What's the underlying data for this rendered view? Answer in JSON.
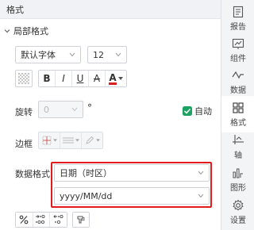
{
  "panel": {
    "title": "格式"
  },
  "section": {
    "title": "局部格式"
  },
  "font": {
    "family": "默认字体",
    "size": "12"
  },
  "style_buttons": {
    "bold": "B",
    "italic": "I",
    "underline": "U",
    "strike": "A",
    "color": "A"
  },
  "rotation": {
    "label": "旋转",
    "value": "0",
    "unit": "°",
    "auto_label": "自动",
    "auto_checked": true
  },
  "border": {
    "label": "边框"
  },
  "data_format": {
    "label": "数据格式",
    "type": "日期（时区）",
    "pattern": "yyyy/MM/dd"
  },
  "sidebar": {
    "tabs": [
      {
        "label": "报告",
        "icon": "report-icon"
      },
      {
        "label": "组件",
        "icon": "component-icon"
      },
      {
        "label": "数据",
        "icon": "data-icon"
      },
      {
        "label": "格式",
        "icon": "format-icon",
        "active": true
      },
      {
        "label": "轴",
        "icon": "axis-icon"
      },
      {
        "label": "图形",
        "icon": "graph-icon"
      },
      {
        "label": "设置",
        "icon": "settings-icon"
      }
    ]
  },
  "colors": {
    "highlight": "#e41a1a",
    "checkbox": "#1aa260",
    "font_color_bar": "#d81e1e"
  }
}
